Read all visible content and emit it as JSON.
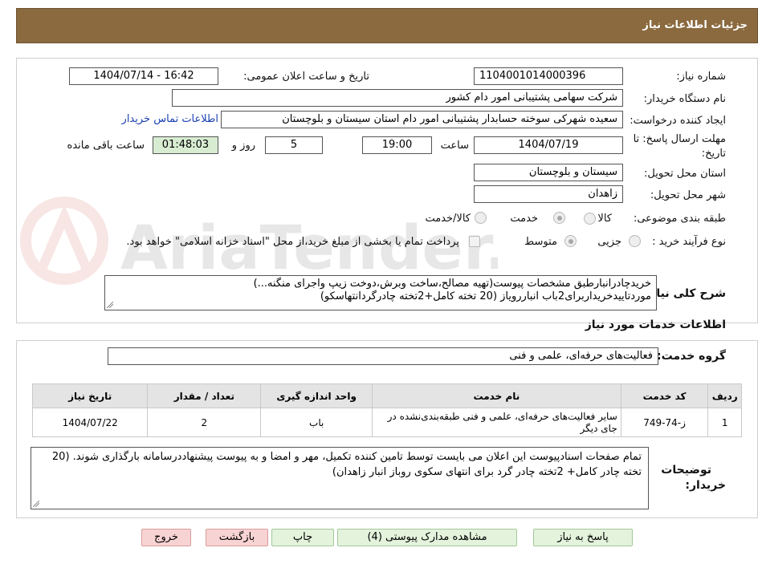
{
  "header": {
    "title": "جزئیات اطلاعات نیاز"
  },
  "fields": {
    "need_number_label": "شماره نیاز:",
    "need_number": "1104001014000396",
    "announce_label": "تاریخ و ساعت اعلان عمومی:",
    "announce_value": "1404/07/14 - 16:42",
    "buyer_org_label": "نام دستگاه خریدار:",
    "buyer_org": "شرکت سهامی پشتیبانی امور دام کشور",
    "requester_label": "ایجاد کننده درخواست:",
    "requester": "سعیده شهرکی سوخته حسابدار پشتیبانی امور دام استان سیستان و بلوچستان",
    "contact_link": "اطلاعات تماس خریدار",
    "deadline_label_1": "مهلت ارسال پاسخ: تا",
    "deadline_label_2": "تاریخ:",
    "deadline_date": "1404/07/19",
    "time_label": "ساعت",
    "deadline_time": "19:00",
    "days_value": "5",
    "days_label": "روز و",
    "remaining_time": "01:48:03",
    "remaining_label": "ساعت باقی مانده",
    "province_label": "استان محل تحویل:",
    "province": "سیستان و بلوچستان",
    "city_label": "شهر محل تحویل:",
    "city": "زاهدان",
    "category_label": "طبقه بندی موضوعی:",
    "category_options": [
      "کالا",
      "خدمت",
      "کالا/خدمت"
    ],
    "process_label": "نوع فرآیند خرید :",
    "process_options": [
      "جزیی",
      "متوسط"
    ],
    "payment_note": "پرداخت تمام یا بخشی از مبلغ خرید،از محل \"اسناد خزانه اسلامی\" خواهد بود.",
    "summary_label": "شرح کلی نیاز:",
    "summary_line1": "خریدچادرانبارطبق مشخصات پیوست(تهیه مصالح،ساخت وبرش،دوخت زیپ واجرای منگنه...)",
    "summary_line2": "موردتاییدخریداربرای2باب انباررویاز (20 تخته کامل+2تخته چادرگردانتهاسکو)"
  },
  "services": {
    "section_title": "اطلاعات خدمات مورد نیاز",
    "group_label": "گروه خدمت:",
    "group_value": "فعالیت‌های حرفه‌ای، علمی و فنی",
    "columns": [
      "ردیف",
      "کد خدمت",
      "نام خدمت",
      "واحد اندازه گیری",
      "تعداد / مقدار",
      "تاریخ نیاز"
    ],
    "rows": [
      [
        "1",
        "ز-74-749",
        "سایر فعالیت‌های حرفه‌ای، علمی و فنی طبقه‌بندی‌نشده در جای دیگر",
        "باب",
        "2",
        "1404/07/22"
      ]
    ]
  },
  "buyer_notes": {
    "label_1": "توضیحات",
    "label_2": "خریدار:",
    "text": "تمام صفحات اسنادپیوست این اعلان می بایست توسط تامین کننده تکمیل، مهر و امضا و به پیوست پیشنهاددرسامانه بارگذاری شوند. (20 تخته چادر کامل+ 2تخته چادر گرد برای انتهای سکوی روباز انبار زاهدان)"
  },
  "buttons": {
    "reply": "پاسخ به نیاز",
    "attachments": "مشاهده مدارک پیوستی (4)",
    "print": "چاپ",
    "back": "بازگشت",
    "exit": "خروج"
  },
  "watermark": {
    "text": "AriaTender.neT"
  },
  "colors": {
    "header": "#8b6a3f",
    "link": "#1a3fb3",
    "green_button": "#e3f3dc",
    "red_button": "#f8d3d3"
  }
}
